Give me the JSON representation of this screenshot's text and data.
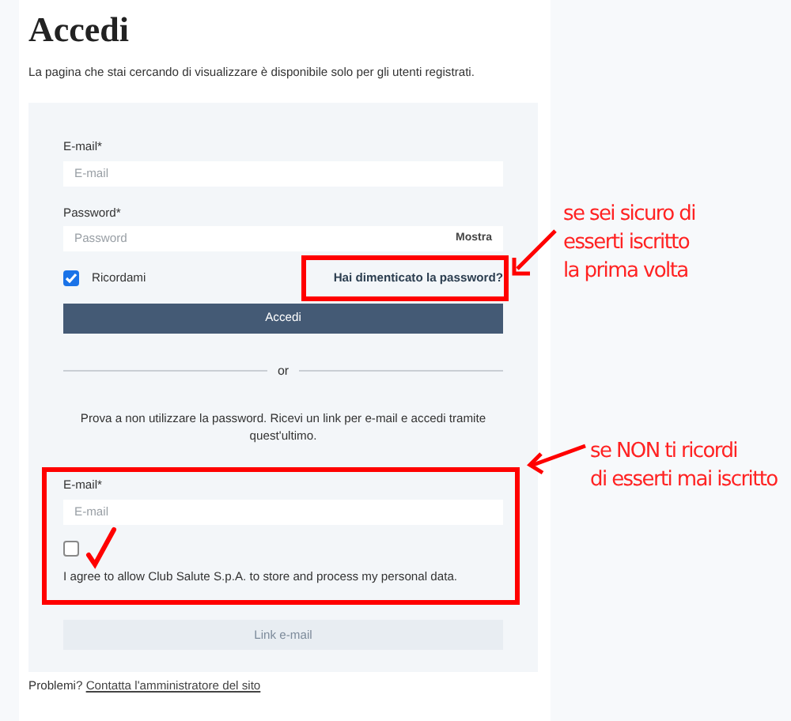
{
  "page": {
    "title": "Accedi",
    "intro": "La pagina che stai cercando di visualizzare è disponibile solo per gli utenti registrati."
  },
  "login_form": {
    "email_label": "E-mail*",
    "email_placeholder": "E-mail",
    "password_label": "Password*",
    "password_placeholder": "Password",
    "show_password": "Mostra",
    "remember": {
      "label": "Ricordami",
      "checked": true
    },
    "forgot_link": "Hai dimenticato la password?",
    "submit": "Accedi"
  },
  "separator": "or",
  "magic_link": {
    "intro": "Prova a non utilizzare la password. Ricevi un link per e-mail e accedi tramite quest'ultimo.",
    "email_label": "E-mail*",
    "email_placeholder": "E-mail",
    "consent": {
      "label": "I agree to allow Club Salute S.p.A. to store and process my personal data.",
      "checked": false
    },
    "submit": {
      "label": "Link e-mail",
      "disabled": true
    }
  },
  "footer": {
    "text": "Problemi?",
    "link": "Contatta l'amministratore del sito"
  },
  "annotations": [
    {
      "lines": [
        "se sei sicuro di",
        "esserti iscritto",
        "la prima volta"
      ]
    },
    {
      "lines": [
        "se NON ti ricordi",
        "di esserti mai iscritto"
      ]
    }
  ]
}
